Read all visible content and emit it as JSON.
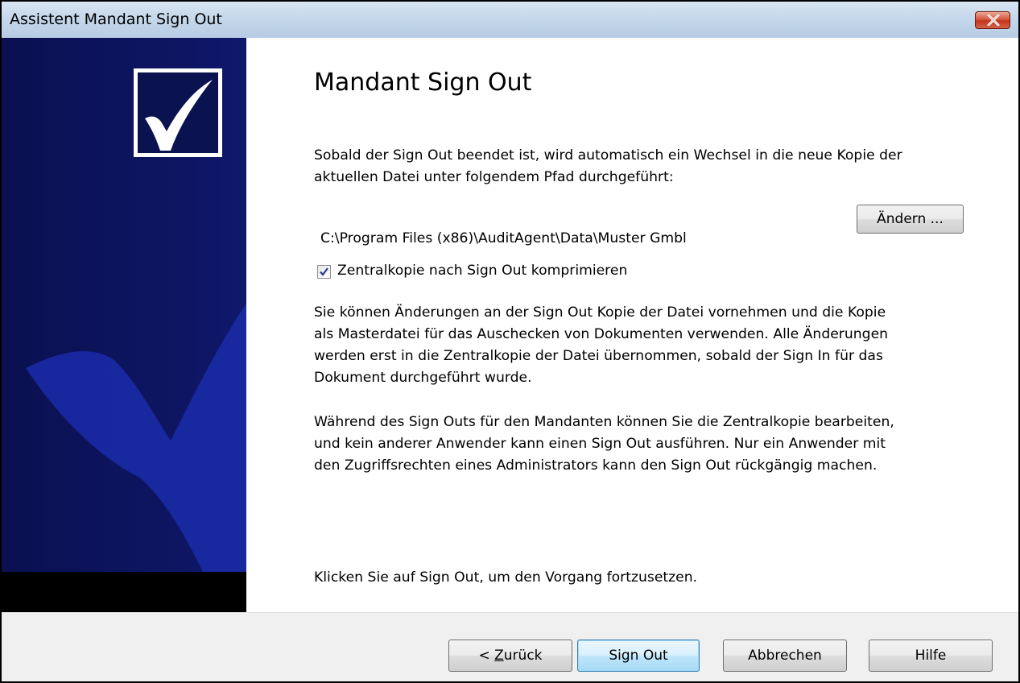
{
  "window": {
    "title": "Assistent Mandant Sign Out"
  },
  "sidebar": {
    "background_color": "#000000",
    "accent_color": "#0d1559",
    "checkmark_icon": "checkmark-icon"
  },
  "content": {
    "heading": "Mandant Sign Out",
    "intro": "Sobald der Sign Out beendet ist, wird automatisch ein Wechsel in die neue Kopie der\naktuellen Datei unter folgendem Pfad durchgeführt:",
    "path": "C:\\Program Files (x86)\\AuditAgent\\Data\\Muster Gmbl",
    "change_button": "Ändern ...",
    "checkbox_label": "Zentralkopie nach Sign Out komprimieren",
    "checkbox_checked": true,
    "paragraph1": "Sie können Änderungen an der Sign Out Kopie der Datei vornehmen und die Kopie\nals Masterdatei für das Auschecken von Dokumenten verwenden. Alle Änderungen\nwerden erst in die Zentralkopie der Datei übernommen, sobald der Sign In für das\nDokument durchgeführt wurde.",
    "paragraph2": "Während des Sign Outs für den Mandanten können Sie die Zentralkopie bearbeiten,\nund kein anderer Anwender kann einen Sign Out ausführen. Nur ein Anwender mit\nden Zugriffsrechten eines Administrators kann den Sign Out rückgängig machen.",
    "instruction": "Klicken Sie auf Sign Out, um den Vorgang fortzusetzen."
  },
  "footer": {
    "back_prefix": "< ",
    "back_mnemonic": "Z",
    "back_rest": "urück",
    "signout_button": "Sign Out",
    "cancel_button": "Abbrechen",
    "help_button": "Hilfe"
  }
}
